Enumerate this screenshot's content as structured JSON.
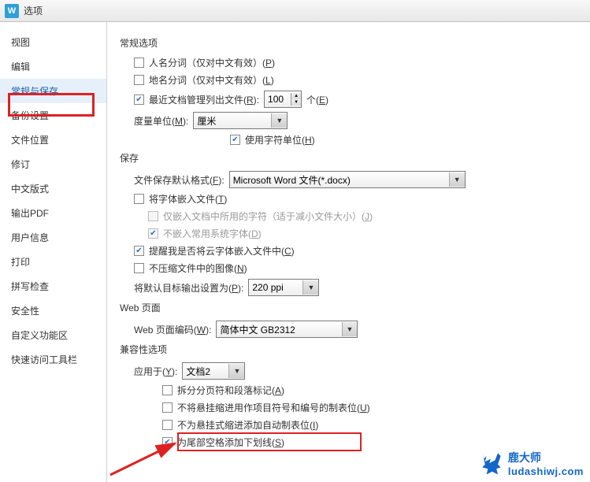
{
  "titlebar": {
    "app_icon_letter": "W",
    "title": "选项"
  },
  "sidebar": {
    "items": [
      {
        "label": "视图"
      },
      {
        "label": "编辑"
      },
      {
        "label": "常规与保存",
        "selected": true
      },
      {
        "label": "备份设置"
      },
      {
        "label": "文件位置"
      },
      {
        "label": "修订"
      },
      {
        "label": "中文版式"
      },
      {
        "label": "输出PDF"
      },
      {
        "label": "用户信息"
      },
      {
        "label": "打印"
      },
      {
        "label": "拼写检查"
      },
      {
        "label": "安全性"
      },
      {
        "label": "自定义功能区"
      },
      {
        "label": "快速访问工具栏"
      }
    ]
  },
  "general": {
    "section": "常规选项",
    "person_split": "人名分词（仅对中文有效）(",
    "person_split_hk": "P",
    "person_split_suf": ")",
    "place_split": "地名分词（仅对中文有效）(",
    "place_split_hk": "L",
    "place_split_suf": ")",
    "recent_pre": "最近文档管理列出文件(",
    "recent_hk": "R",
    "recent_suf": "):",
    "recent_count": "100",
    "recent_unit_pre": "个(",
    "recent_unit_hk": "E",
    "recent_unit_suf": ")",
    "measure_pre": "度量单位(",
    "measure_hk": "M",
    "measure_suf": "):",
    "measure_val": "厘米",
    "char_unit_pre": "使用字符单位(",
    "char_unit_hk": "H",
    "char_unit_suf": ")"
  },
  "save": {
    "section": "保存",
    "default_fmt_pre": "文件保存默认格式(",
    "default_fmt_hk": "F",
    "default_fmt_suf": "):",
    "default_fmt_val": "Microsoft Word 文件(*.docx)",
    "embed_pre": "将字体嵌入文件(",
    "embed_hk": "T",
    "embed_suf": ")",
    "embed_sub_pre": "仅嵌入文档中所用的字符（适于减小文件大小）(",
    "embed_sub_hk": "J",
    "embed_sub_suf": ")",
    "embed_sys_pre": "不嵌入常用系统字体(",
    "embed_sys_hk": "D",
    "embed_sys_suf": ")",
    "cloud_warn_pre": "提醒我是否将云字体嵌入文件中(",
    "cloud_warn_hk": "C",
    "cloud_warn_suf": ")",
    "nocomp_pre": "不压缩文件中的图像(",
    "nocomp_hk": "N",
    "nocomp_suf": ")",
    "target_pre": "将默认目标输出设置为(",
    "target_hk": "P",
    "target_suf": "):",
    "target_val": "220 ppi"
  },
  "web": {
    "section": "Web 页面",
    "enc_pre": "Web 页面编码(",
    "enc_hk": "W",
    "enc_suf": "):",
    "enc_val": "简体中文 GB2312"
  },
  "compat": {
    "section": "兼容性选项",
    "apply_pre": "应用于(",
    "apply_hk": "Y",
    "apply_suf": "):",
    "apply_val": "文档2",
    "opt1_pre": "拆分分页符和段落标记(",
    "opt1_hk": "A",
    "opt1_suf": ")",
    "opt2_pre": "不将悬挂缩进用作项目符号和编号的制表位(",
    "opt2_hk": "U",
    "opt2_suf": ")",
    "opt3_pre": "不为悬挂式缩进添加自动制表位(",
    "opt3_hk": "I",
    "opt3_suf": ")",
    "opt4_pre": "为尾部空格添加下划线(",
    "opt4_hk": "S",
    "opt4_suf": ")"
  },
  "watermark": {
    "brand": "鹿大师",
    "url": "ludashiwj.com"
  }
}
